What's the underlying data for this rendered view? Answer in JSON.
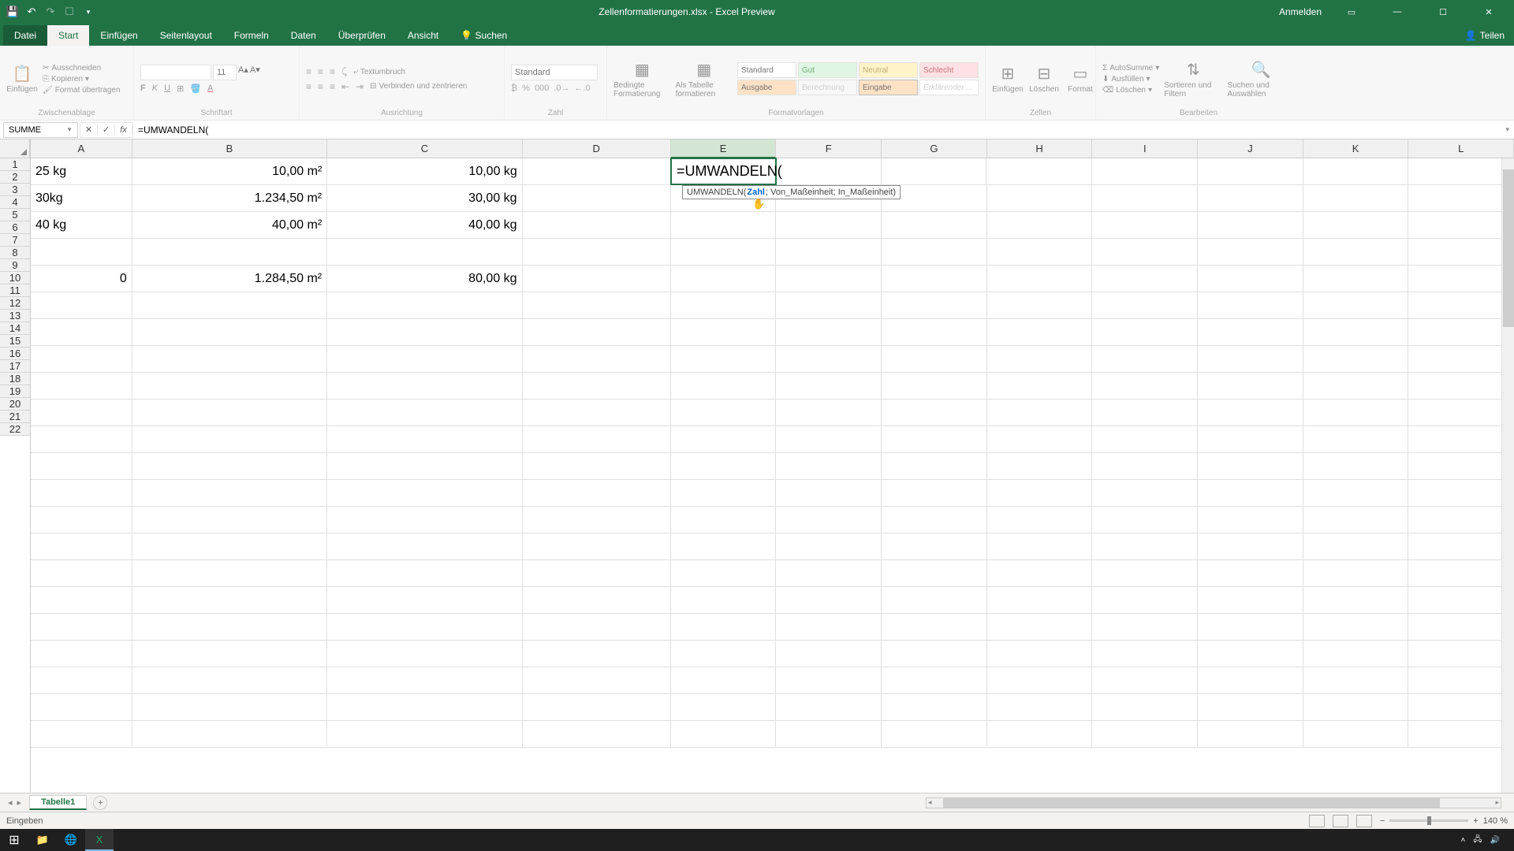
{
  "titlebar": {
    "title": "Zellenformatierungen.xlsx - Excel Preview",
    "signin": "Anmelden"
  },
  "ribbon": {
    "tabs": {
      "file": "Datei",
      "home": "Start",
      "insert": "Einfügen",
      "pagelayout": "Seitenlayout",
      "formulas": "Formeln",
      "data": "Daten",
      "review": "Überprüfen",
      "view": "Ansicht",
      "search": "Suchen",
      "share": "Teilen"
    },
    "clipboard": {
      "paste": "Einfügen",
      "cut": "Ausschneiden",
      "copy": "Kopieren",
      "formatpainter": "Format übertragen",
      "label": "Zwischenablage"
    },
    "font": {
      "size": "11",
      "label": "Schriftart"
    },
    "alignment": {
      "wrap": "Textumbruch",
      "merge": "Verbinden und zentrieren",
      "label": "Ausrichtung"
    },
    "number": {
      "format": "Standard",
      "label": "Zahl"
    },
    "styles": {
      "cond": "Bedingte Formatierung",
      "table": "Als Tabelle formatieren",
      "standard": "Standard",
      "gut": "Gut",
      "neutral": "Neutral",
      "schlecht": "Schlecht",
      "ausgabe": "Ausgabe",
      "berechnung": "Berechnung",
      "eingabe": "Eingabe",
      "erklarend": "Erklärender ...",
      "label": "Formatvorlagen"
    },
    "cells": {
      "insert": "Einfügen",
      "delete": "Löschen",
      "format": "Format",
      "label": "Zellen"
    },
    "editing": {
      "autosum": "AutoSumme",
      "fill": "Ausfüllen",
      "clear": "Löschen",
      "sort": "Sortieren und Filtern",
      "find": "Suchen und Auswählen",
      "label": "Bearbeiten"
    }
  },
  "fbar": {
    "namebox": "SUMME",
    "formula": "=UMWANDELN("
  },
  "cols": [
    "A",
    "B",
    "C",
    "D",
    "E",
    "F",
    "G",
    "H",
    "I",
    "J",
    "K",
    "L"
  ],
  "rows": [
    "1",
    "2",
    "3",
    "4",
    "5",
    "6",
    "7",
    "8",
    "9",
    "10",
    "11",
    "12",
    "13",
    "14",
    "15",
    "16",
    "17",
    "18",
    "19",
    "20",
    "21",
    "22"
  ],
  "data": {
    "A1": "25 kg",
    "B1": "10,00 m²",
    "C1": "10,00 kg",
    "E1": "=UMWANDELN(",
    "A2": "30kg",
    "B2": "1.234,50 m²",
    "C2": "30,00 kg",
    "A3": "40 kg",
    "B3": "40,00 m²",
    "C3": "40,00 kg",
    "A5": "0",
    "B5": "1.284,50 m²",
    "C5": "80,00 kg"
  },
  "tooltip": {
    "fn": "UMWANDELN(",
    "arg1": "Zahl",
    "rest": "; Von_Maßeinheit; In_Maßeinheit)"
  },
  "sheet": {
    "name": "Tabelle1"
  },
  "status": {
    "mode": "Eingeben",
    "zoom": "140 %"
  },
  "taskbar": {
    "time": ""
  }
}
